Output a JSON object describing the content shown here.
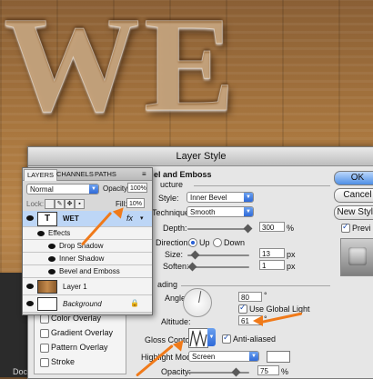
{
  "canvas": {
    "text": "WE"
  },
  "status": {
    "doc_label": "Doc:"
  },
  "dialog": {
    "title": "Layer Style",
    "bevel_header": "el and Emboss",
    "structure_header": "ucture",
    "style_label": "Style:",
    "style_value": "Inner Bevel",
    "technique_label": "Technique:",
    "technique_value": "Smooth",
    "depth_label": "Depth:",
    "depth_value": "300",
    "depth_unit": "%",
    "direction_label": "Direction:",
    "dir_up": "Up",
    "dir_down": "Down",
    "size_label": "Size:",
    "size_value": "13",
    "size_unit": "px",
    "soften_label": "Soften:",
    "soften_value": "1",
    "soften_unit": "px",
    "shading_header": "ading",
    "angle_label": "Angle:",
    "angle_value": "80",
    "angle_unit": "°",
    "global_light_label": "Use Global Light",
    "altitude_label": "Altitude:",
    "altitude_value": "61",
    "altitude_unit": "°",
    "gloss_label": "Gloss Contour:",
    "antialiased_label": "Anti-aliased",
    "highlight_label": "Highlight Mode:",
    "highlight_value": "Screen",
    "opacity_label": "Opacity:",
    "opacity_value": "75",
    "opacity_unit": "%",
    "buttons": {
      "ok": "OK",
      "cancel": "Cancel",
      "new_style": "New Style",
      "preview": "Previ"
    },
    "styles_list": [
      "Color Overlay",
      "Gradient Overlay",
      "Pattern Overlay",
      "Stroke"
    ]
  },
  "layers": {
    "tabs": [
      "LAYERS",
      "CHANNELS",
      "PATHS"
    ],
    "blend_mode": "Normal",
    "opacity_label": "Opacity:",
    "opacity_value": "100%",
    "lock_label": "Lock:",
    "fill_label": "Fill:",
    "fill_value": "10%",
    "rows": [
      {
        "name": "WET",
        "thumb": "T",
        "fx": "fx"
      },
      {
        "name": "Effects"
      },
      {
        "name": "Drop Shadow"
      },
      {
        "name": "Inner Shadow"
      },
      {
        "name": "Bevel and Emboss"
      },
      {
        "name": "Layer 1"
      },
      {
        "name": "Background"
      }
    ]
  },
  "colors": {
    "arrow": "#f07a1a",
    "selection": "#bdd6f6",
    "accent": "#2f6ad8"
  }
}
